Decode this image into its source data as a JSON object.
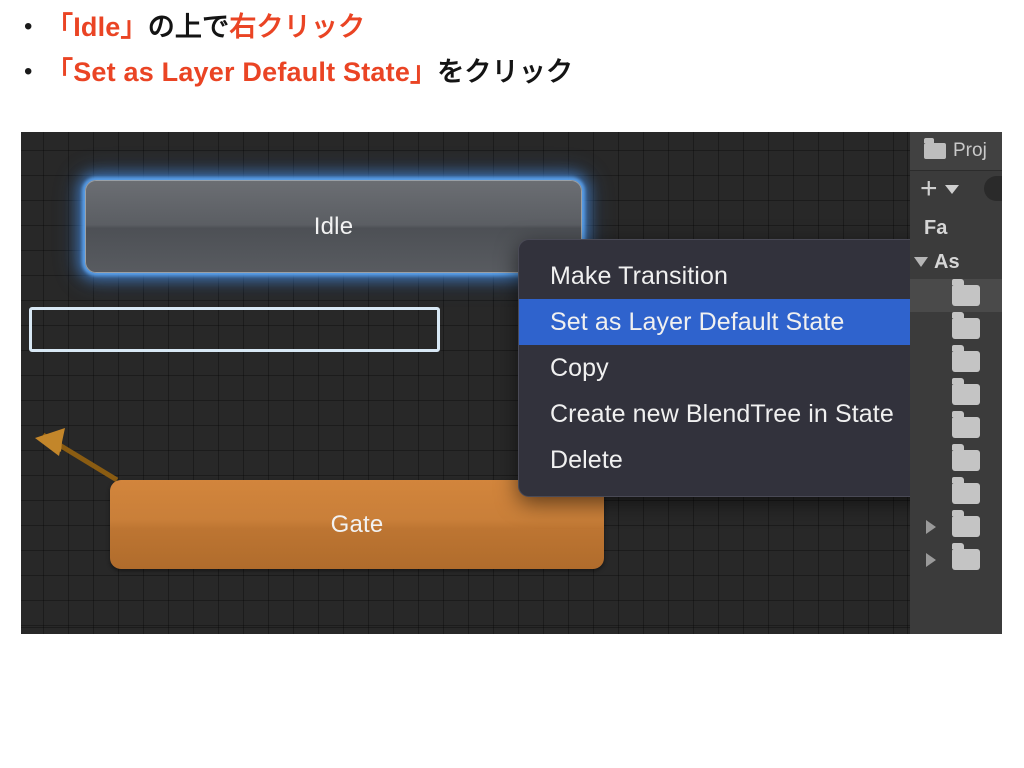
{
  "slide": {
    "bullets": [
      {
        "marker": "•",
        "segments": [
          {
            "text": "「Idle」",
            "accent": true
          },
          {
            "text": "の上で",
            "accent": false
          },
          {
            "text": "右クリック",
            "accent": true
          }
        ]
      },
      {
        "marker": "•",
        "segments": [
          {
            "text": "「Set as Layer Default State」",
            "accent": true
          },
          {
            "text": "をクリック",
            "accent": false
          }
        ]
      }
    ],
    "accent_color": "#ea4424",
    "text_color": "#141414"
  },
  "screenshot": {
    "animator_graph": {
      "nodes": [
        {
          "name": "idle-state-node",
          "label": "Idle",
          "style": "selected-gray",
          "glow_color": "#4a8fe0"
        },
        {
          "name": "gate-state-node",
          "label": "Gate",
          "style": "orange",
          "fill_color": "#c97f39"
        }
      ],
      "transition": {
        "name": "transition-arrow",
        "color": "#8a5c12",
        "direction": "up-left"
      },
      "background_color": "#282828"
    },
    "context_menu": {
      "items": [
        {
          "label": "Make Transition",
          "selected": false
        },
        {
          "label": "Set as Layer Default State",
          "selected": true
        },
        {
          "label": "Copy",
          "selected": false
        },
        {
          "label": "Create new BlendTree in State",
          "selected": false
        },
        {
          "label": "Delete",
          "selected": false
        }
      ],
      "selected_bg": "#2f63cd",
      "menu_bg": "#32323c",
      "annotation_border": "#d8e8f5"
    },
    "project_panel": {
      "tab_label": "Proj",
      "tab_icon": "folder-icon",
      "toolbar": {
        "create_label": "+",
        "create_dropdown_icon": "chevron-down-icon",
        "search_placeholder": ""
      },
      "tree": {
        "favorites_label": "Fa",
        "assets_label": "As",
        "rows": [
          {
            "icon": "folder-icon",
            "expandable": false,
            "selected": true
          },
          {
            "icon": "folder-icon",
            "expandable": false,
            "selected": false
          },
          {
            "icon": "folder-icon",
            "expandable": false,
            "selected": false
          },
          {
            "icon": "folder-icon",
            "expandable": false,
            "selected": false
          },
          {
            "icon": "folder-icon",
            "expandable": false,
            "selected": false
          },
          {
            "icon": "folder-icon",
            "expandable": false,
            "selected": false
          },
          {
            "icon": "folder-icon",
            "expandable": false,
            "selected": false
          },
          {
            "icon": "folder-icon",
            "expandable": true,
            "selected": false
          },
          {
            "icon": "folder-icon",
            "expandable": true,
            "selected": false
          }
        ]
      }
    }
  }
}
